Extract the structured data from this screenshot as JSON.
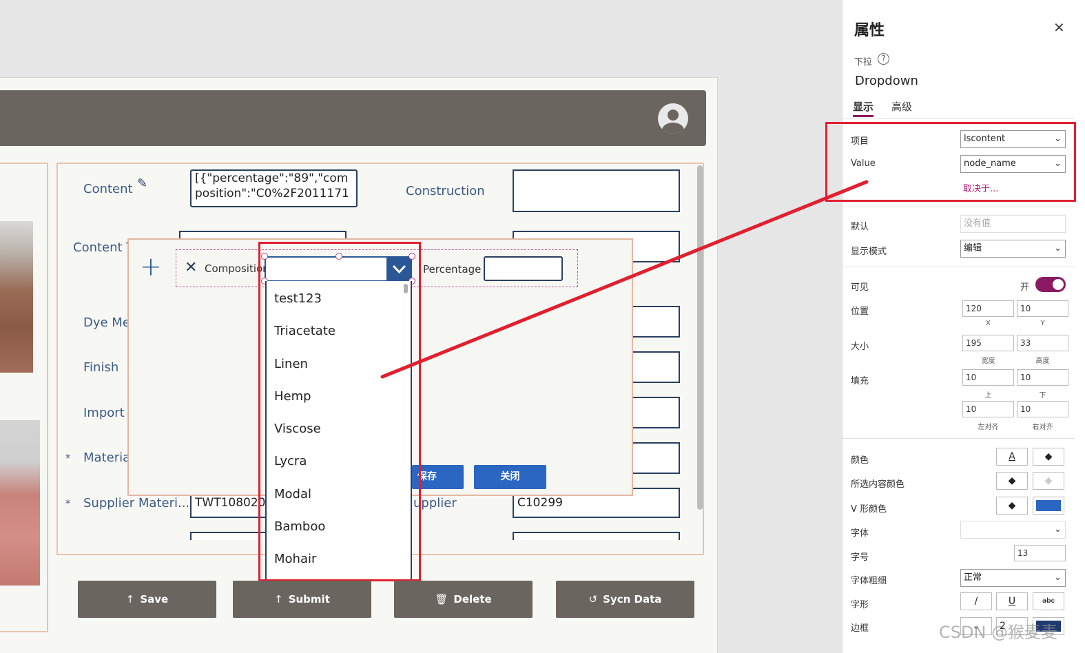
{
  "form": {
    "fields": [
      {
        "label": "Content",
        "value": "[{\"percentage\":\"89\",\"com position\":\"C0%2F2011171"
      },
      {
        "label": "Construction",
        "value": ""
      },
      {
        "label": "Content T",
        "value": ""
      },
      {
        "label": "Dye Me",
        "value": ""
      },
      {
        "label": "Finish",
        "value": ""
      },
      {
        "label": "Import",
        "value": ""
      },
      {
        "label": "Materia",
        "value": ""
      },
      {
        "label": "Supplier Materi...",
        "value": "TWT108020"
      },
      {
        "label": "upplier",
        "value": "C10299"
      }
    ],
    "content_line1": "[{\"percentage\":\"89\",\"com",
    "content_line2": "position\":\"C0%2F2011171",
    "required_mark": "*"
  },
  "popup": {
    "plus": "+",
    "composition_label": "Composition",
    "percentage_label": "Percentage",
    "save_label": "保存",
    "close_label": "关闭"
  },
  "dropdown": {
    "items": [
      "test123",
      "Triacetate",
      "Linen",
      "Hemp",
      "Viscose",
      "Lycra",
      "Modal",
      "Bamboo",
      "Mohair"
    ]
  },
  "buttons": {
    "save": "Save",
    "submit": "Submit",
    "delete": "Delete",
    "sync": "Sycn Data"
  },
  "props": {
    "title": "属性",
    "control_kind": "下拉",
    "control_name": "Dropdown",
    "tab_display": "显示",
    "tab_advanced": "高级",
    "items_label": "项目",
    "items_value": "lscontent",
    "value_label": "Value",
    "value_value": "node_name",
    "depends_on": "取决于...",
    "default_label": "默认",
    "default_placeholder": "没有值",
    "display_mode_label": "显示模式",
    "display_mode_value": "编辑",
    "visible_label": "可见",
    "visible_state": "开",
    "position_label": "位置",
    "pos_x": "120",
    "pos_y": "10",
    "cap_x": "X",
    "cap_y": "Y",
    "size_label": "大小",
    "width": "195",
    "height": "33",
    "cap_width": "宽度",
    "cap_height": "高度",
    "padding_label": "填充",
    "pad_top": "10",
    "pad_bottom": "10",
    "cap_top": "上",
    "cap_bottom": "下",
    "pad_left": "10",
    "pad_right": "10",
    "cap_left": "左对齐",
    "cap_right": "右对齐",
    "color_label": "颜色",
    "selection_color_label": "所选内容颜色",
    "chevron_color_label": "V 形颜色",
    "font_label": "字体",
    "font_size_label": "字号",
    "font_size": "13",
    "font_weight_label": "字体粗细",
    "font_weight": "正常",
    "font_style_label": "字形",
    "border_label": "边框",
    "border_width": "2",
    "color_a": "A",
    "italic": "/",
    "underline": "U",
    "strike": "abc"
  },
  "watermark": "CSDN @猴麦麦",
  "colors": {
    "accent": "#8a1a64",
    "header": "#6a655e",
    "button_blue": "#2b66c2",
    "annotation_red": "#e02030",
    "chevron_swatch": "#2b66c2"
  }
}
